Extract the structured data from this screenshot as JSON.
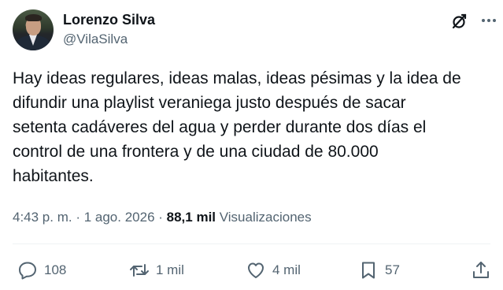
{
  "author": {
    "name": "Lorenzo Silva",
    "handle": "@VilaSilva"
  },
  "tweet": {
    "text": "Hay ideas regulares, ideas malas, ideas pésimas y la idea de\ndifundir una playlist veraniega justo después de sacar\nsetenta cadáveres del agua y perder durante dos días el\ncontrol de una frontera y de una ciudad de 80.000\nhabitantes."
  },
  "meta": {
    "time": "4:43 p. m.",
    "sep1": " · ",
    "date": "1 ago. 2026",
    "sep2": " · ",
    "views_count": "88,1 mil",
    "views_label": " Visualizaciones"
  },
  "actions": {
    "replies": "108",
    "reposts": "1 mil",
    "likes": "4 mil",
    "bookmarks": "57"
  },
  "icons": [
    "grok-icon",
    "more-icon",
    "reply-icon",
    "repost-icon",
    "like-icon",
    "bookmark-icon",
    "share-icon"
  ],
  "colors": {
    "text": "#0f1419",
    "secondary": "#536471",
    "divider": "#eff3f4"
  }
}
